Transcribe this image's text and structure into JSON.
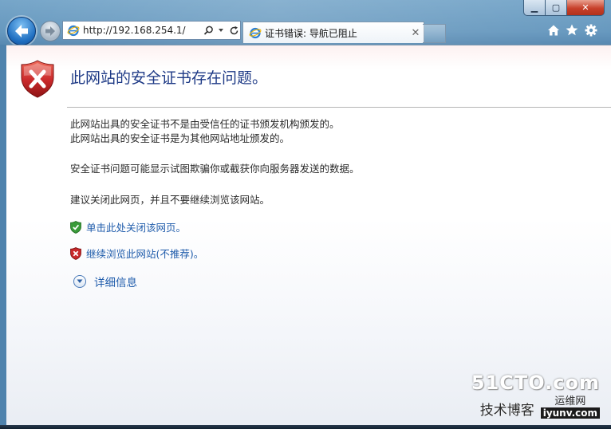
{
  "browser": {
    "address_url": "http://192.168.254.1/",
    "tab_title": "证书错误: 导航已阻止",
    "tab_close": "✕",
    "window_controls": {
      "minimize": "▁",
      "maximize": "▢",
      "close": "✕"
    },
    "icons": [
      "back-arrow-icon",
      "forward-arrow-icon",
      "ie-icon",
      "search-icon",
      "refresh-icon",
      "home-icon",
      "favorites-star-icon",
      "tools-gear-icon"
    ]
  },
  "page": {
    "headline": "此网站的安全证书存在问题。",
    "reason_1": "此网站出具的安全证书不是由受信任的证书颁发机构颁发的。",
    "reason_2": "此网站出具的安全证书是为其他网站地址颁发的。",
    "warning": "安全证书问题可能显示试图欺骗你或截获你向服务器发送的数据。",
    "recommendation": "建议关闭此网页，并且不要继续浏览该网站。",
    "close_link": "单击此处关闭该网页。",
    "continue_link": "继续浏览此网站(不推荐)。",
    "details_link": "详细信息"
  },
  "watermark": {
    "brand": "51CTO.com",
    "chinese": "技术博客",
    "ops_text": "运维网",
    "domain": "iyunv.com"
  },
  "colors": {
    "headline_blue": "#1e3a86",
    "link_blue": "#1f5cab",
    "shield_red": "#c8282a",
    "shield_green": "#3a9b3a"
  }
}
